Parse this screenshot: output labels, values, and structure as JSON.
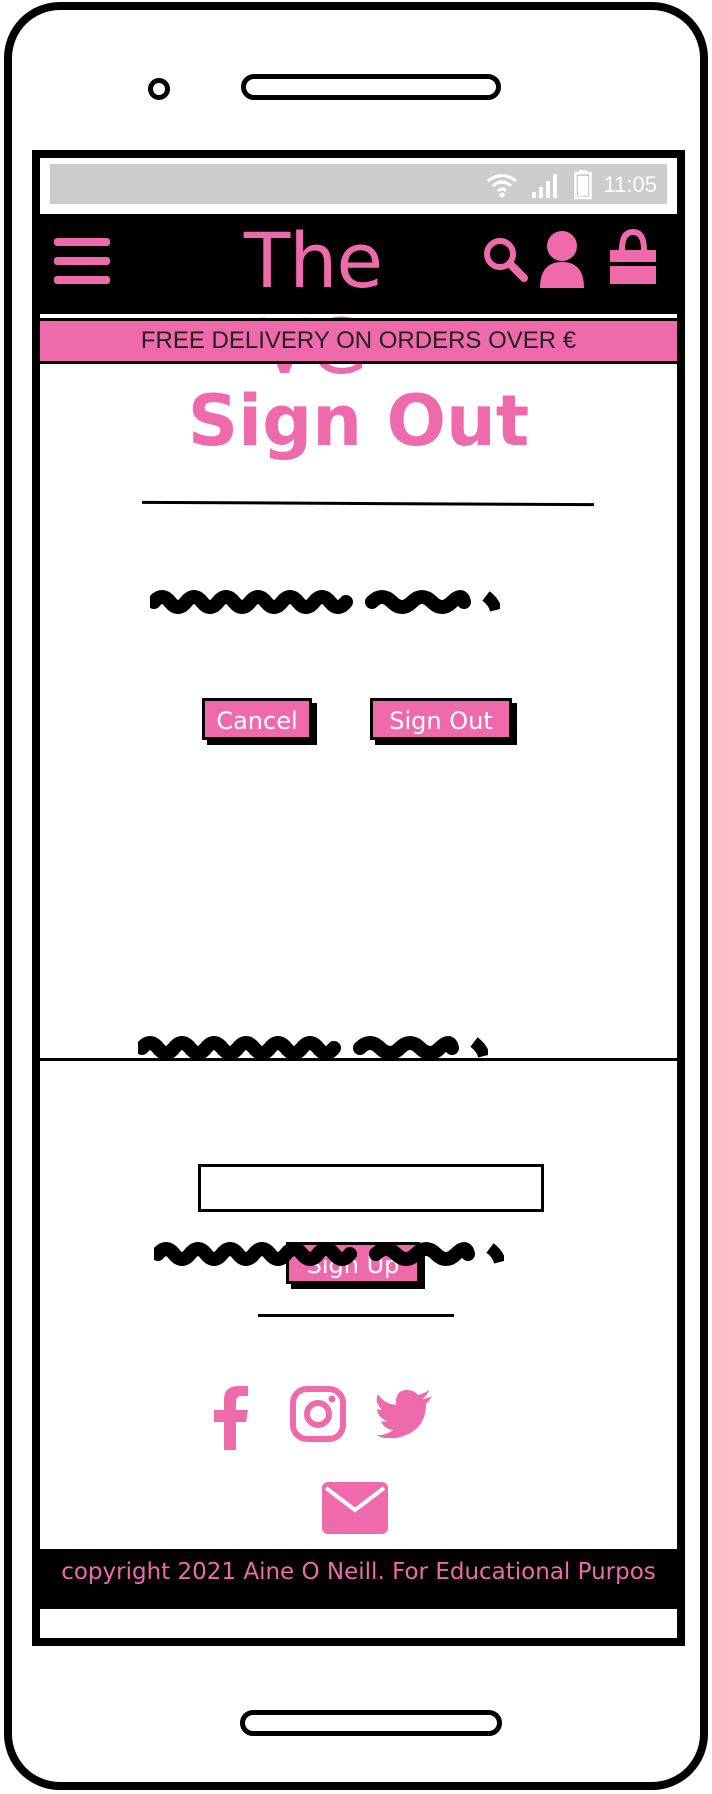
{
  "status_bar": {
    "time": "11:05"
  },
  "header": {
    "logo": "The VG"
  },
  "promo": {
    "text": "FREE DELIVERY ON ORDERS OVER €"
  },
  "main": {
    "title": "Sign Out",
    "cancel_label": "Cancel",
    "signout_label": "Sign Out"
  },
  "newsletter": {
    "email_value": "",
    "signup_label": "Sign Up"
  },
  "footer": {
    "copyright": "copyright 2021 Aine O Neill. For Educational Purpos"
  },
  "colors": {
    "accent": "#ef6aab",
    "dark": "#000000",
    "statusbar": "#cccccc"
  },
  "icons": [
    "menu-icon",
    "search-icon",
    "user-icon",
    "bag-icon",
    "facebook-icon",
    "instagram-icon",
    "twitter-icon",
    "mail-icon",
    "wifi-icon",
    "signal-icon",
    "battery-icon"
  ]
}
